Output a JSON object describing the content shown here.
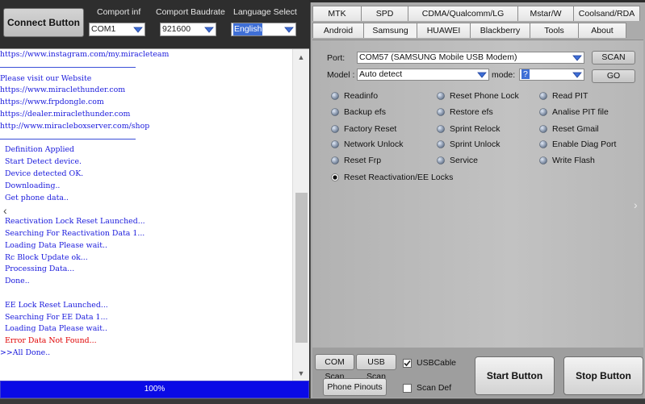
{
  "toolbar": {
    "connect_label": "Connect Button",
    "comport_info": {
      "label": "Comport inf",
      "value": "COM1"
    },
    "baudrate": {
      "label": "Comport Baudrate",
      "value": "921600"
    },
    "language": {
      "label": "Language Select",
      "value": "English"
    }
  },
  "log": {
    "lines": [
      {
        "text": "https://www.instagram.com/my.miracleteam",
        "style": "blue"
      },
      {
        "text": "",
        "style": "sep"
      },
      {
        "text": "Please visit our Website",
        "style": "blue"
      },
      {
        "text": "https://www.miraclethunder.com",
        "style": "blue"
      },
      {
        "text": "https://www.frpdongle.com",
        "style": "blue"
      },
      {
        "text": "https://dealer.miraclethunder.com",
        "style": "blue"
      },
      {
        "text": "http://www.miracleboxserver.com/shop",
        "style": "blue"
      },
      {
        "text": "",
        "style": "sep"
      },
      {
        "text": "  Definition Applied",
        "style": "blue"
      },
      {
        "text": "  Start Detect device.",
        "style": "blue"
      },
      {
        "text": "  Device detected OK.",
        "style": "blue"
      },
      {
        "text": "  Downloading..",
        "style": "blue"
      },
      {
        "text": "  Get phone data..",
        "style": "blue"
      },
      {
        "text": "",
        "style": "blank"
      },
      {
        "text": "  Reactivation Lock Reset Launched...",
        "style": "blue"
      },
      {
        "text": "  Searching For Reactivation Data 1...",
        "style": "blue"
      },
      {
        "text": "  Loading Data Please wait..",
        "style": "blue"
      },
      {
        "text": "  Rc Block Update ok...",
        "style": "blue"
      },
      {
        "text": "  Processing Data...",
        "style": "blue"
      },
      {
        "text": "  Done..",
        "style": "blue"
      },
      {
        "text": "",
        "style": "blank"
      },
      {
        "text": "  EE Lock Reset Launched...",
        "style": "blue"
      },
      {
        "text": "  Searching For EE Data 1...",
        "style": "blue"
      },
      {
        "text": "  Loading Data Please wait..",
        "style": "blue"
      },
      {
        "text": "  Error Data Not Found...",
        "style": "red"
      },
      {
        "text": ">>All Done..",
        "style": "blue"
      }
    ]
  },
  "progress": {
    "label": "100%",
    "value": 1.0
  },
  "tabs_row1": [
    "MTK",
    "SPD",
    "CDMA/Qualcomm/LG",
    "Mstar/W",
    "Coolsand/RDA"
  ],
  "tabs_row2": [
    "Android",
    "Samsung",
    "HUAWEI",
    "Blackberry",
    "Tools",
    "About"
  ],
  "active_tab": "Samsung",
  "samsung": {
    "port_label": "Port:",
    "port_value": "COM57 (SAMSUNG Mobile USB Modem)",
    "scan_label": "SCAN",
    "model_label": "Model :",
    "model_value": "Auto detect",
    "mode_label": "mode:",
    "mode_value": "?",
    "go_label": "GO",
    "options": [
      "Readinfo",
      "Reset Phone Lock",
      "Read PIT",
      "Backup efs",
      "Restore efs",
      "Analise PIT file",
      "Factory Reset",
      "Sprint Relock",
      "Reset Gmail",
      "Network Unlock",
      "Sprint Unlock",
      "Enable Diag Port",
      "Reset Frp",
      "Service",
      "Write Flash",
      "Reset Reactivation/EE Locks"
    ],
    "selected_option": "Reset Reactivation/EE Locks"
  },
  "controls": {
    "com_scan": "COM Scan",
    "usb_scan": "USB Scan",
    "usb_cable": {
      "label": "USBCable",
      "checked": true
    },
    "phone_pinouts": "Phone Pinouts",
    "scan_def": {
      "label": "Scan Def",
      "checked": false
    },
    "start": "Start Button",
    "stop": "Stop Button"
  },
  "colors": {
    "log_blue": "#1a1adc",
    "log_red": "#e00000",
    "progress_blue": "#1010e8",
    "selection": "#3f6fd6"
  }
}
